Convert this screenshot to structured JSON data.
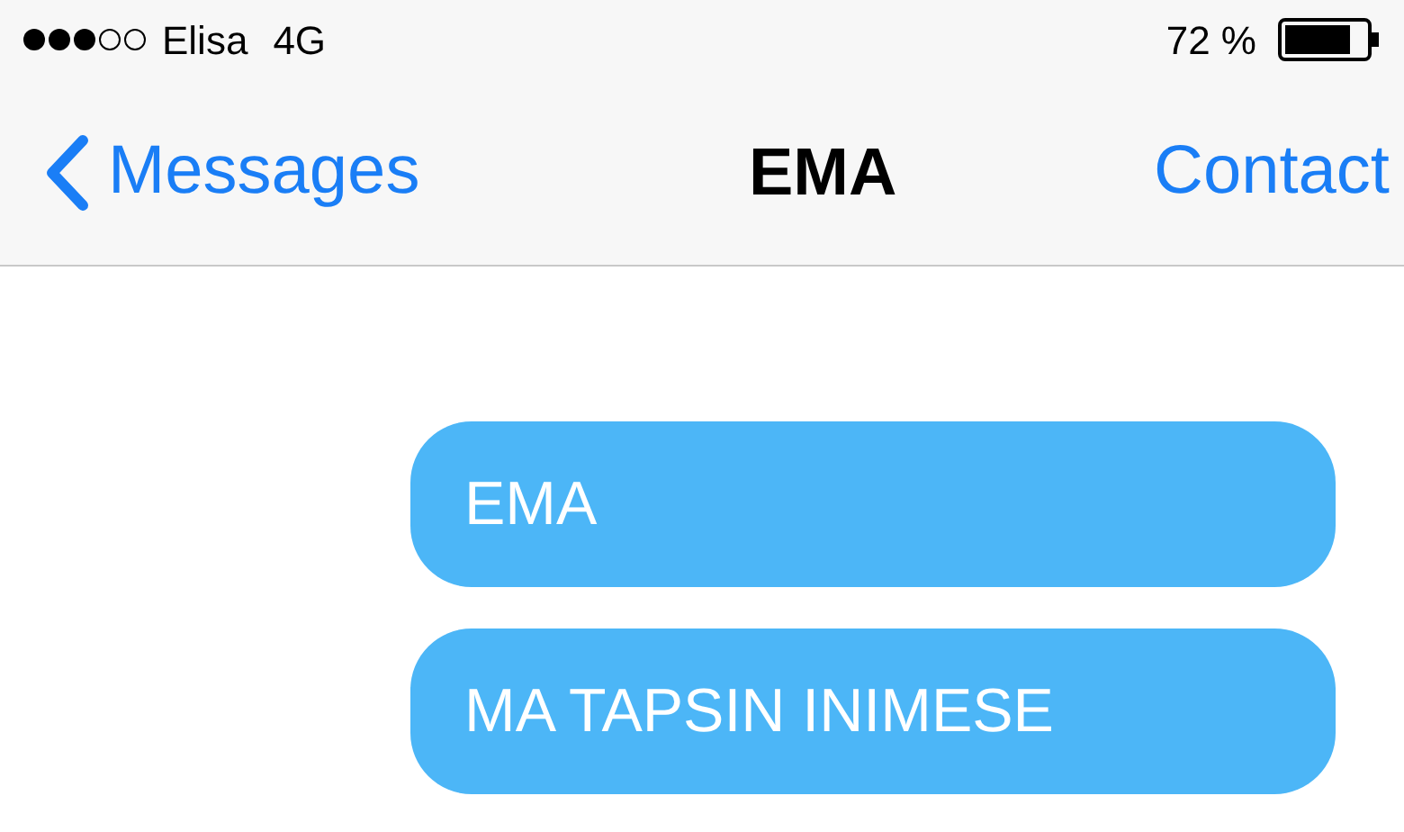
{
  "status_bar": {
    "carrier": "Elisa",
    "network": "4G",
    "battery": "72 %"
  },
  "nav_bar": {
    "back": "Messages",
    "title": "EMA",
    "action": "Contact"
  },
  "messages": [
    {
      "kind": "sent",
      "text": "EMA"
    },
    {
      "kind": "sent",
      "text": "MA TAPSIN INIMESE"
    }
  ]
}
